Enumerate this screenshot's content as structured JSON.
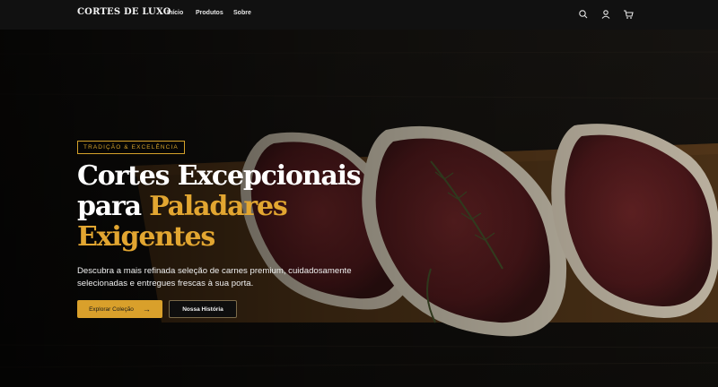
{
  "brand": {
    "name": "CORTES DE LUXO"
  },
  "nav": {
    "links": [
      {
        "label": "Início"
      },
      {
        "label": "Produtos"
      },
      {
        "label": "Sobre"
      }
    ],
    "icons": [
      "search-icon",
      "user-icon",
      "cart-icon"
    ]
  },
  "hero": {
    "badge": "TRADIÇÃO & EXCELÊNCIA",
    "headline": {
      "line1": "Cortes Excepcionais",
      "line2_white": "para ",
      "line2_gold": "Paladares",
      "line3_gold": "Exigentes"
    },
    "description": "Descubra a mais refinada seleção de carnes premium, cuidadosamente selecionadas e entregues frescas à sua porta.",
    "primary_button": {
      "label": "Explorar Coleção",
      "icon": "arrow-right-icon"
    },
    "secondary_button": {
      "label": "Nossa História"
    }
  },
  "colors": {
    "accent": "#d9a02b",
    "navbar": "#111111",
    "text": "#ffffff"
  }
}
